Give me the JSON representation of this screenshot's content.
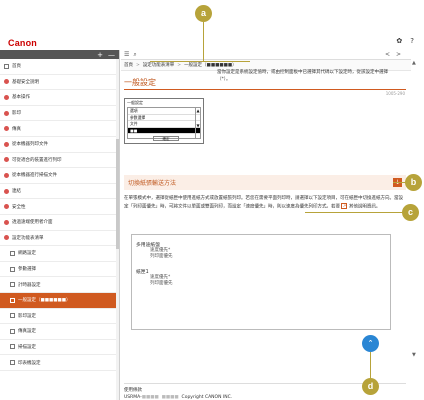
{
  "header": {
    "logo": "Canon",
    "icons": [
      "settings-icon",
      "help-icon"
    ],
    "settings_glyph": "✿",
    "help_glyph": "?"
  },
  "sidebar": {
    "controls": [
      "+",
      "—"
    ],
    "items": [
      {
        "label": "首頁",
        "icon": "box"
      },
      {
        "label": "基礎安全說明",
        "icon": "dot"
      },
      {
        "label": "基本操作",
        "icon": "dot"
      },
      {
        "label": "影印",
        "icon": "dot"
      },
      {
        "label": "傳真",
        "icon": "dot"
      },
      {
        "label": "從本機器列印文件",
        "icon": "dot"
      },
      {
        "label": "可從適合的裝置進行列印",
        "icon": "dot"
      },
      {
        "label": "從本機器進行掃描文件",
        "icon": "dot"
      },
      {
        "label": "連結",
        "icon": "dot"
      },
      {
        "label": "安全性",
        "icon": "dot"
      },
      {
        "label": "透過遠端使用者介面",
        "icon": "dot"
      },
      {
        "label": "設定功能表清單",
        "icon": "dot"
      },
      {
        "label": "網路設定",
        "icon": "box",
        "sub": true
      },
      {
        "label": "參數選擇",
        "icon": "box",
        "sub": true
      },
      {
        "label": "計時器設定",
        "icon": "box",
        "sub": true
      },
      {
        "label": "一般設定（■■■■■■）",
        "icon": "box",
        "sub": true,
        "active": true
      },
      {
        "label": "影印設定",
        "icon": "box",
        "sub": true
      },
      {
        "label": "傳真設定",
        "icon": "box",
        "sub": true
      },
      {
        "label": "掃描設定",
        "icon": "box",
        "sub": true
      },
      {
        "label": "印表機設定",
        "icon": "box",
        "sub": true
      }
    ]
  },
  "content": {
    "toolbar": {
      "menu_icon": "☰",
      "search_icon": "⌕",
      "prev": "<",
      "next": ">"
    },
    "breadcrumb": [
      "首頁",
      "設定功能表清單",
      "一般設定（■■■■■■）"
    ],
    "title": "一般設定",
    "doc_number": "1005-290",
    "panel": {
      "title": "一般設定",
      "rows": [
        "選項",
        "參數選擇",
        "文件",
        "■■"
      ],
      "selected_index": 3,
      "button": "確定"
    },
    "description": "當你設定是系統設定值時，或由控制面板中已選擇其代碼以下設定時，從該設定中選擇（*）。",
    "section_title": "切換紙張輸送方法",
    "body": "在單張模式中，選擇從紙匣中使用進紙方式或放置紙張列印。若您在需要平面列印時，請選擇以下設定項目，可在紙匣中切換進紙方向。當設定「列印面優先」時，可將文件以單面或雙面列印，而設定「速度優先」時，則以速度為優先列印方式。若要",
    "link_glyph": "↗",
    "body_tail": "其他說明資訊。",
    "options": [
      {
        "heading": "多用途紙盤",
        "items": [
          "速度優先*",
          "列印面優先"
        ]
      },
      {
        "heading": "紙匣1",
        "items": [
          "速度優先*",
          "列印面優先"
        ]
      }
    ],
    "footer": {
      "line1": "使用條款",
      "line2_prefix": "USRMA-",
      "line2_mask": "■■■■",
      "copyright": "Copyright CANON INC."
    },
    "top_button_glyph": "⌃",
    "section_toggle_glyph": "↓"
  },
  "callouts": [
    "a",
    "b",
    "c",
    "d"
  ],
  "colors": {
    "accent": "#d05a20",
    "callout": "#b7a33a",
    "brand": "#cc0000",
    "top_button": "#2a86d4"
  }
}
